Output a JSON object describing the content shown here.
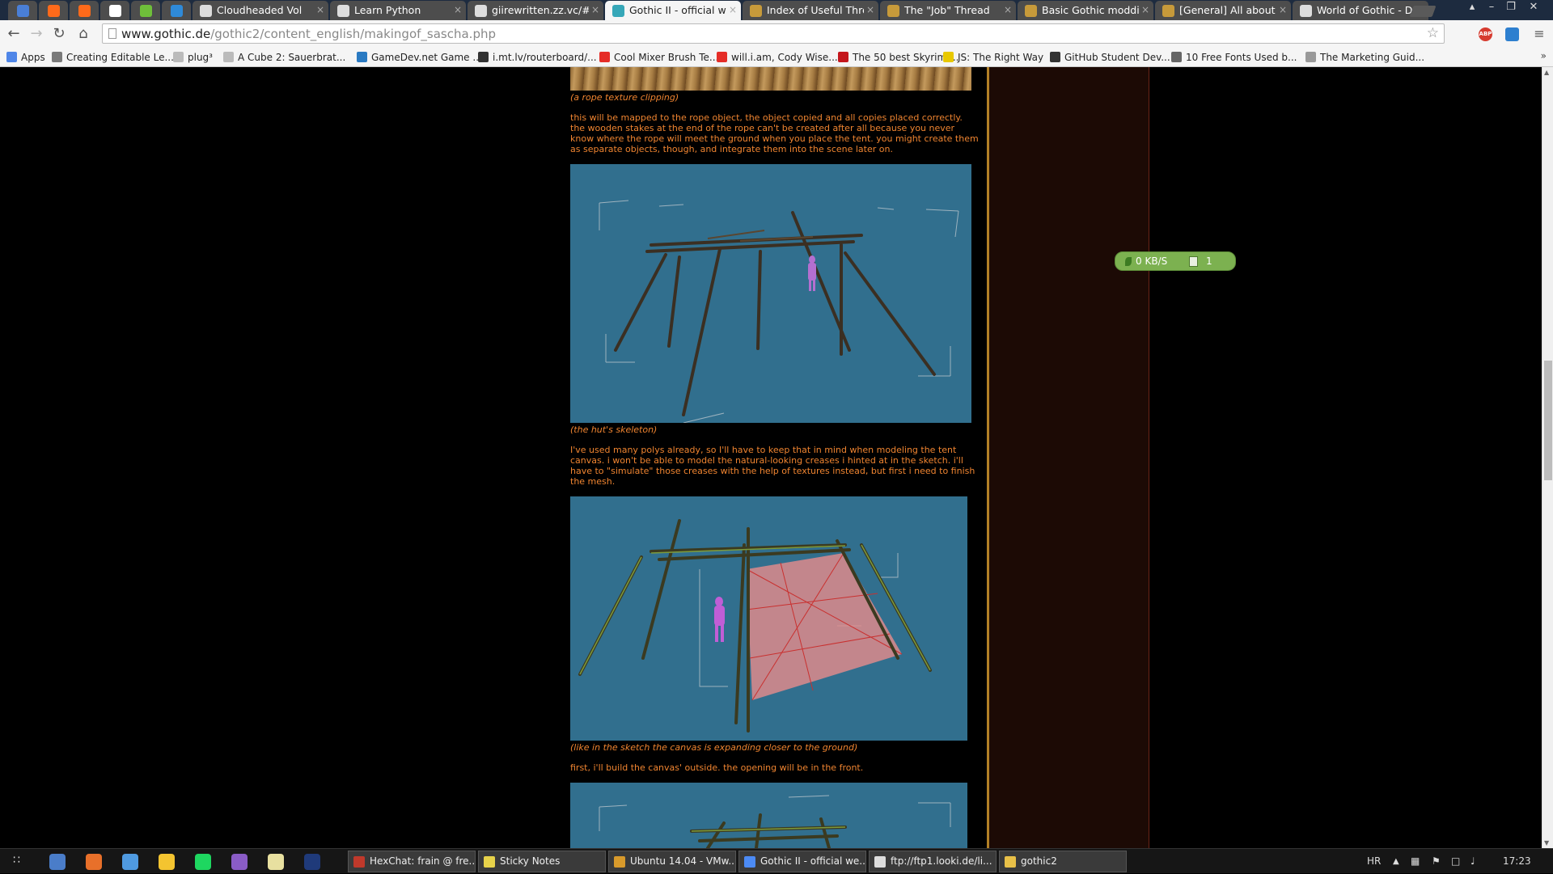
{
  "tabs": [
    {
      "title": "",
      "icon": "google-sites-icon",
      "pinned": true,
      "active": false
    },
    {
      "title": "",
      "icon": "soundcloud-icon",
      "pinned": true,
      "active": false
    },
    {
      "title": "",
      "icon": "soundcloud-icon",
      "pinned": true,
      "active": false
    },
    {
      "title": "",
      "icon": "wikipedia-icon",
      "pinned": true,
      "active": false
    },
    {
      "title": "",
      "icon": "green-dot-icon",
      "pinned": true,
      "active": false
    },
    {
      "title": "",
      "icon": "blue-wave-icon",
      "pinned": true,
      "active": false
    },
    {
      "title": "Cloudheaded Vol",
      "icon": "page-icon",
      "pinned": false,
      "active": false
    },
    {
      "title": "Learn Python",
      "icon": "page-icon",
      "pinned": false,
      "active": false
    },
    {
      "title": "giirewritten.zz.vc/#",
      "icon": "page-icon",
      "pinned": false,
      "active": false
    },
    {
      "title": "Gothic II - official wel",
      "icon": "gothic-icon",
      "pinned": false,
      "active": true
    },
    {
      "title": "Index of Useful Threa",
      "icon": "gear-icon",
      "pinned": false,
      "active": false
    },
    {
      "title": "The \"Job\" Thread",
      "icon": "gear-icon",
      "pinned": false,
      "active": false
    },
    {
      "title": "Basic Gothic moddin",
      "icon": "gear-icon",
      "pinned": false,
      "active": false
    },
    {
      "title": "[General] All about sc",
      "icon": "gear-icon",
      "pinned": false,
      "active": false
    },
    {
      "title": "World of Gothic - Do",
      "icon": "page-icon",
      "pinned": false,
      "active": false
    }
  ],
  "address": {
    "host": "www.gothic.de",
    "path": "/gothic2/content_english/makingof_sascha.php"
  },
  "extensions": [
    {
      "label": "ABP",
      "color": "#d63b2f",
      "icon": "adblock-icon"
    },
    {
      "label": "",
      "color": "#2d7fcf",
      "icon": "stats-icon"
    }
  ],
  "bookmarks": [
    {
      "label": "Apps",
      "icon": "apps-grid-icon"
    },
    {
      "label": "Creating Editable Le...",
      "icon": "bookmark-v-icon"
    },
    {
      "label": "plug³",
      "icon": "page-icon"
    },
    {
      "label": "A Cube 2: Sauerbrat...",
      "icon": "page-icon"
    },
    {
      "label": "GameDev.net Game ...",
      "icon": "gamedev-icon"
    },
    {
      "label": "i.mt.lv/routerboard/...",
      "icon": "mikrotik-icon"
    },
    {
      "label": "Cool Mixer Brush Te...",
      "icon": "youtube-icon"
    },
    {
      "label": "will.i.am, Cody Wise...",
      "icon": "youtube-icon"
    },
    {
      "label": "The 50 best Skyrim ...",
      "icon": "pcgamer-icon"
    },
    {
      "label": "JS: The Right Way",
      "icon": "js-icon"
    },
    {
      "label": "GitHub Student Dev...",
      "icon": "github-icon"
    },
    {
      "label": "10 Free Fonts Used b...",
      "icon": "fonts-icon"
    },
    {
      "label": "The Marketing Guid...",
      "icon": "p-icon"
    }
  ],
  "article": {
    "caption_rope": "(a rope texture clipping)",
    "para_rope": "this will be mapped to the rope object, the object copied and all copies placed correctly. the wooden stakes at the end of the rope can't be created after all because you never know where the rope will meet the ground when you place the tent. you might create them as separate objects, though, and integrate them into the scene later on.",
    "caption_skeleton": "(the hut's skeleton)",
    "para_polys": "I've used many polys already, so I'll have to keep that in mind when modeling the tent canvas. i won't be able to model the natural-looking creases i hinted at in the sketch. i'll have to \"simulate\" those creases with the help of textures instead, but first i need to finish the mesh.",
    "caption_canvas": "(like in the sketch the canvas is expanding closer to the ground)",
    "para_canvas": "first, i'll build the canvas' outside. the opening will be in the front."
  },
  "net_widget": {
    "speed": "0 KB/S",
    "count": "1"
  },
  "taskbar": {
    "pinned": [
      "windows-start-icon",
      "tools-icon",
      "firefox-icon",
      "calculator-icon",
      "shield-icon",
      "spotify-icon",
      "visual-studio-icon",
      "notepad-icon",
      "photoshop-icon"
    ],
    "tasks": [
      {
        "label": "HexChat: frain @ fre...",
        "icon": "hexchat-icon",
        "color": "#c0392b"
      },
      {
        "label": "Sticky Notes",
        "icon": "sticky-notes-icon",
        "color": "#e7d24a"
      },
      {
        "label": "Ubuntu 14.04 - VMw...",
        "icon": "vmware-icon",
        "color": "#d89a2b"
      },
      {
        "label": "Gothic II - official we...",
        "icon": "chrome-icon",
        "color": "#4c8bf5"
      },
      {
        "label": "ftp://ftp1.looki.de/li...",
        "icon": "page-icon",
        "color": "#dddddd"
      },
      {
        "label": "gothic2",
        "icon": "folder-icon",
        "color": "#e8c048"
      }
    ],
    "lang": "HR",
    "time": "17:23"
  }
}
